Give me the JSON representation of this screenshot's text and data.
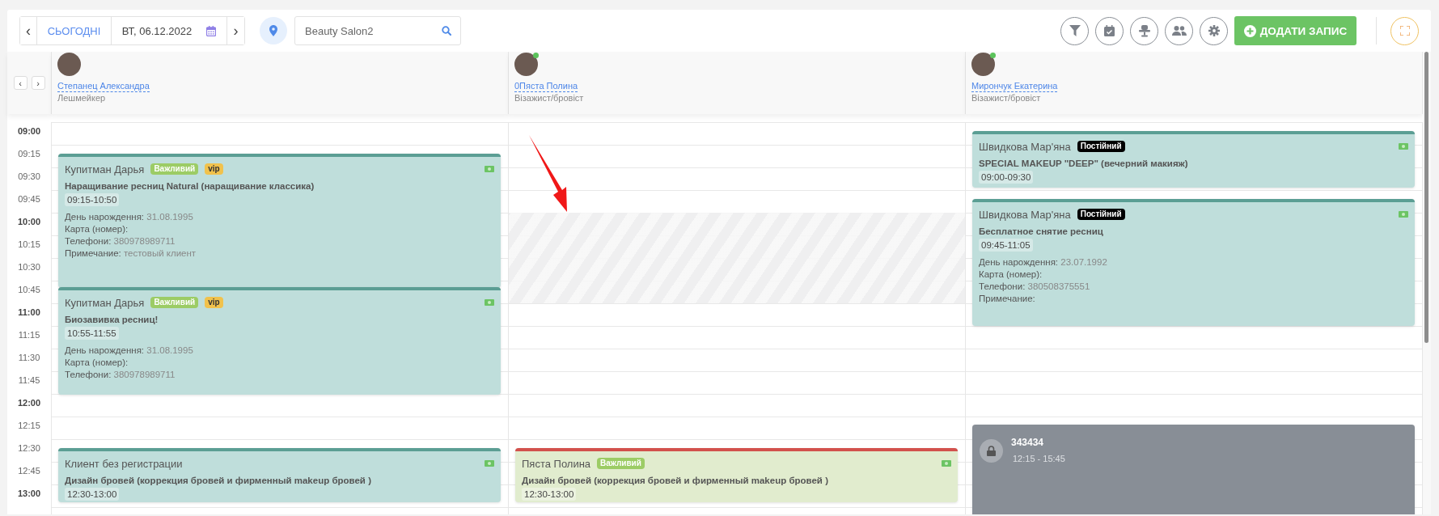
{
  "toolbar": {
    "prev": "‹",
    "today": "СЬОГОДНІ",
    "date": "ВТ, 06.12.2022",
    "next": "›",
    "location_search": {
      "value": "Beauty Salon2"
    },
    "add_button": "ДОДАТИ ЗАПИС"
  },
  "staff_nav": {
    "prev": "‹",
    "next": "›"
  },
  "staff": [
    {
      "name": "Степанец Александра",
      "role": "Лешмейкер",
      "online": false
    },
    {
      "name": "0Пяста Полина",
      "role": "Візажист/бровіст",
      "online": true
    },
    {
      "name": "Мирончук Екатерина",
      "role": "Візажист/бровіст",
      "online": true
    }
  ],
  "time_labels": [
    {
      "label": "09:00",
      "kind": "hour"
    },
    {
      "label": "09:15",
      "kind": "quarter"
    },
    {
      "label": "09:30",
      "kind": "quarter"
    },
    {
      "label": "09:45",
      "kind": "quarter"
    },
    {
      "label": "10:00",
      "kind": "hour"
    },
    {
      "label": "10:15",
      "kind": "quarter"
    },
    {
      "label": "10:30",
      "kind": "quarter"
    },
    {
      "label": "10:45",
      "kind": "quarter"
    },
    {
      "label": "11:00",
      "kind": "hour"
    },
    {
      "label": "11:15",
      "kind": "quarter"
    },
    {
      "label": "11:30",
      "kind": "quarter"
    },
    {
      "label": "11:45",
      "kind": "quarter"
    },
    {
      "label": "12:00",
      "kind": "hour"
    },
    {
      "label": "12:15",
      "kind": "quarter"
    },
    {
      "label": "12:30",
      "kind": "quarter"
    },
    {
      "label": "12:45",
      "kind": "quarter"
    },
    {
      "label": "13:00",
      "kind": "hour"
    }
  ],
  "columns": [
    {
      "events": [
        {
          "kind": "confirmed",
          "client": "Купитман Дарья",
          "tags": [
            {
              "label": "Важливий",
              "kind": "important"
            },
            {
              "label": "vip",
              "kind": "vip"
            }
          ],
          "service": "Наращивание ресниц Natural (наращивание классика)",
          "time": "09:15-10:50",
          "details": [
            {
              "label": "День нарождення:",
              "value": "31.08.1995"
            },
            {
              "label": "Карта (номер):"
            },
            {
              "label": "Телефони:",
              "value": "380978989711"
            },
            {
              "label": "Примечание:",
              "value": "тестовый клиент"
            }
          ]
        },
        {
          "kind": "confirmed",
          "client": "Купитман Дарья",
          "tags": [
            {
              "label": "Важливий",
              "kind": "important"
            },
            {
              "label": "vip",
              "kind": "vip"
            }
          ],
          "service": "Биозавивка ресниц!",
          "time": "10:55-11:55",
          "details": [
            {
              "label": "День нарождення:",
              "value": "31.08.1995"
            },
            {
              "label": "Карта (номер):"
            },
            {
              "label": "Телефони:",
              "value": "380978989711"
            }
          ]
        },
        {
          "kind": "confirmed",
          "client": "Клиент без регистрации",
          "service": "Дизайн бровей (коррекция бровей и фирменный makeup бровей )",
          "time": "12:30-13:00"
        }
      ]
    },
    {
      "blocked_slot": true,
      "events": [
        {
          "kind": "pending",
          "client": "Пяста Полина",
          "tags": [
            {
              "label": "Важливий",
              "kind": "important"
            }
          ],
          "service": "Дизайн бровей (коррекция бровей и фирменный makeup бровей )",
          "time": "12:30-13:00"
        }
      ]
    },
    {
      "events": [
        {
          "kind": "confirmed",
          "client": "Швидкова Мар'яна",
          "tags": [
            {
              "label": "Постійний",
              "kind": "regular"
            }
          ],
          "service": "SPECIAL MAKEUP \"DEEP\" (вечерний макияж)",
          "time": "09:00-09:30"
        },
        {
          "kind": "confirmed",
          "client": "Швидкова Мар'яна",
          "tags": [
            {
              "label": "Постійний",
              "kind": "regular"
            }
          ],
          "service": "Бесплатное снятие ресниц",
          "time": "09:45-11:05",
          "details": [
            {
              "label": "День нарождення:",
              "value": "23.07.1992"
            },
            {
              "label": "Карта (номер):"
            },
            {
              "label": "Телефони:",
              "value": "380508375551"
            },
            {
              "label": "Примечание:"
            }
          ]
        },
        {
          "kind": "blocked",
          "title": "343434",
          "time": "12:15 - 15:45"
        }
      ]
    }
  ]
}
